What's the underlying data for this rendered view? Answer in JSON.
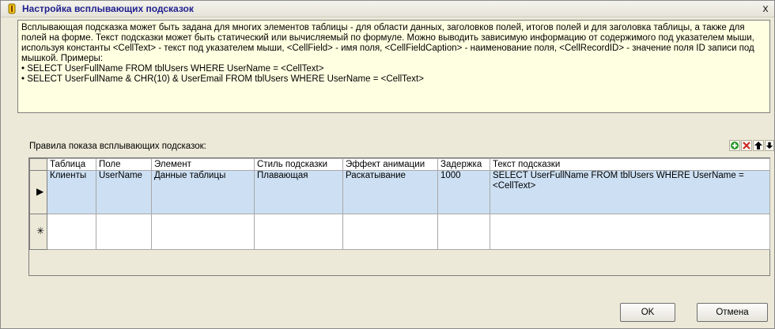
{
  "window": {
    "title": "Настройка всплывающих подсказок",
    "close_label": "x"
  },
  "info": {
    "paragraph": "Всплывающая подсказка может быть задана для многих элементов таблицы - для области данных, заголовков полей, итогов полей и для заголовка таблицы, а также для полей на форме. Текст подсказки может быть статический или вычисляемый по формуле. Можно выводить зависимую информацию от содержимого под указателем мыши, используя константы <CellText> - текст под указателем мыши, <CellField> - имя поля, <CellFieldCaption> - наименование поля, <CellRecordID> - значение поля ID записи под мышкой. Примеры:",
    "example1": "• SELECT UserFullName FROM tblUsers WHERE UserName = <CellText>",
    "example2": "• SELECT UserFullName & CHR(10) & UserEmail FROM tblUsers WHERE UserName = <CellText>"
  },
  "grid": {
    "label": "Правила показа всплывающих подсказок:",
    "columns": [
      "Таблица",
      "Поле",
      "Элемент",
      "Стиль подсказки",
      "Эффект анимации",
      "Задержка",
      "Текст подсказки"
    ],
    "rows": [
      [
        "Клиенты",
        "UserName",
        "Данные таблицы",
        "Плавающая",
        "Раскатывание",
        "1000",
        "SELECT UserFullName FROM tblUsers WHERE UserName = <CellText>"
      ]
    ],
    "current_row_marker": "▶",
    "new_row_marker": "✳"
  },
  "toolbar": {
    "add_icon": "plus-icon",
    "delete_icon": "delete-icon",
    "up_icon": "arrow-up-icon",
    "down_icon": "arrow-down-icon"
  },
  "buttons": {
    "ok_label": "OK",
    "cancel_label": "Отмена"
  },
  "colors": {
    "info_background": "#ffffe1",
    "selected_row": "#cde0f3",
    "title_text": "#1f1f8f",
    "add_icon_color": "#2a9a2a",
    "delete_icon_color": "#cc2222"
  }
}
